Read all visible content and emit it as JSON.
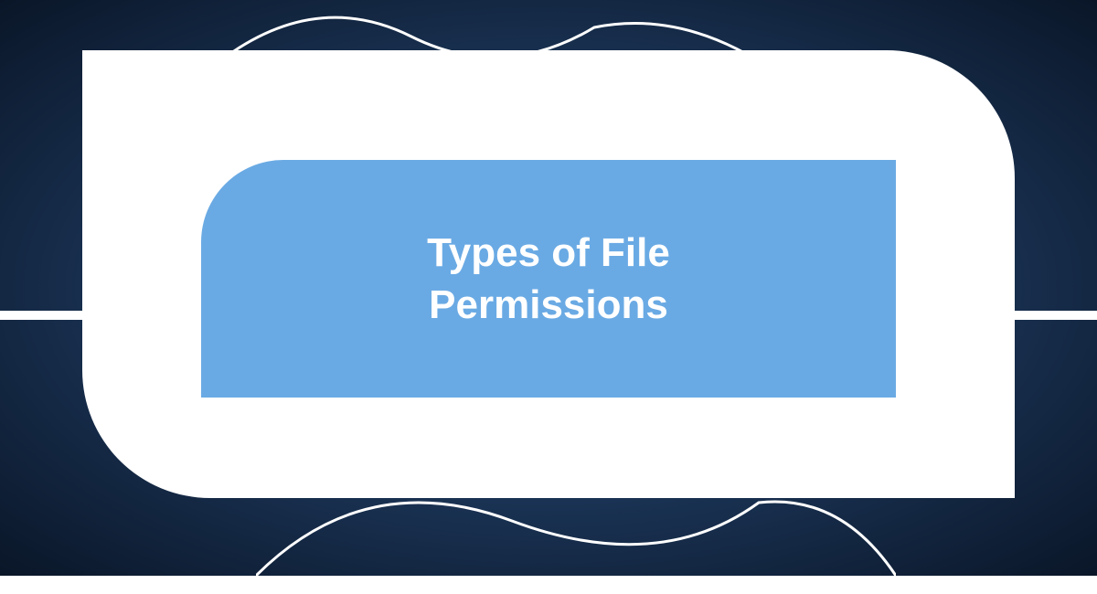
{
  "title": "Types of File\nPermissions",
  "colors": {
    "background_dark": "#0a1628",
    "background_mid": "#1e3a5f",
    "background_light": "#4a7ab8",
    "shape_white": "#ffffff",
    "inner_blue": "#6aaae4",
    "text_white": "#ffffff"
  }
}
